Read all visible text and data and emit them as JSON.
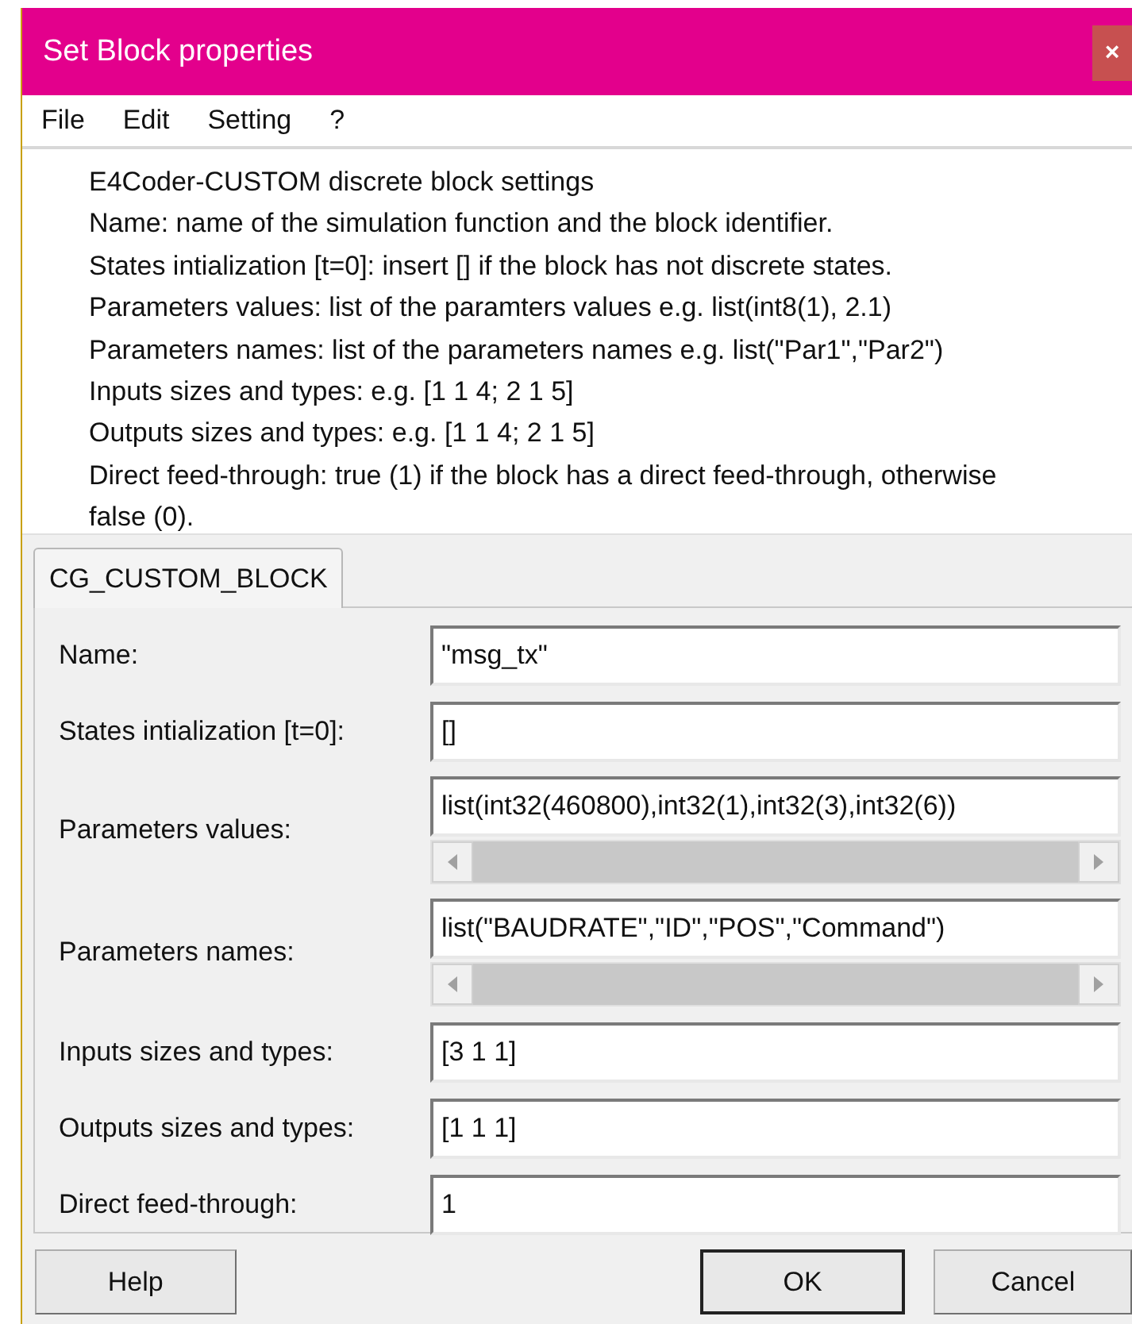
{
  "window": {
    "title": "Set Block properties",
    "close": "×"
  },
  "menu": [
    "File",
    "Edit",
    "Setting",
    "?"
  ],
  "description": [
    "E4Coder-CUSTOM discrete block settings",
    "Name: name of the simulation function and the block identifier.",
    "States intialization [t=0]: insert [] if the block has not discrete states.",
    "Parameters values: list of the paramters values e.g. list(int8(1), 2.1)",
    "Parameters names: list of the parameters names e.g. list(\"Par1\",\"Par2\")",
    "Inputs sizes and types: e.g. [1 1 4; 2 1 5]",
    "Outputs sizes and types: e.g. [1 1 4; 2 1 5]",
    "Direct feed-through: true (1) if the block has a direct feed-through, otherwise false (0)."
  ],
  "tabs": [
    {
      "label": "CG_CUSTOM_BLOCK",
      "selected": true
    }
  ],
  "fields": [
    {
      "label": "Name:",
      "value": "\"msg_tx\"",
      "kind": "text"
    },
    {
      "label": "States intialization [t=0]:",
      "value": "[]",
      "kind": "text"
    },
    {
      "label": "Parameters values:",
      "value": "list(int32(460800),int32(1),int32(3),int32(6))",
      "kind": "scroll"
    },
    {
      "label": "Parameters names:",
      "value": "list(\"BAUDRATE\",\"ID\",\"POS\",\"Command\")",
      "kind": "scroll"
    },
    {
      "label": "Inputs sizes and types:",
      "value": "[3 1 1]",
      "kind": "text"
    },
    {
      "label": "Outputs sizes and types:",
      "value": "[1 1 1]",
      "kind": "text"
    },
    {
      "label": "Direct feed-through:",
      "value": "1",
      "kind": "text"
    }
  ],
  "buttons": [
    {
      "label": "Help",
      "default": false
    },
    {
      "label": "OK",
      "default": true
    },
    {
      "label": "Cancel",
      "default": false
    }
  ]
}
